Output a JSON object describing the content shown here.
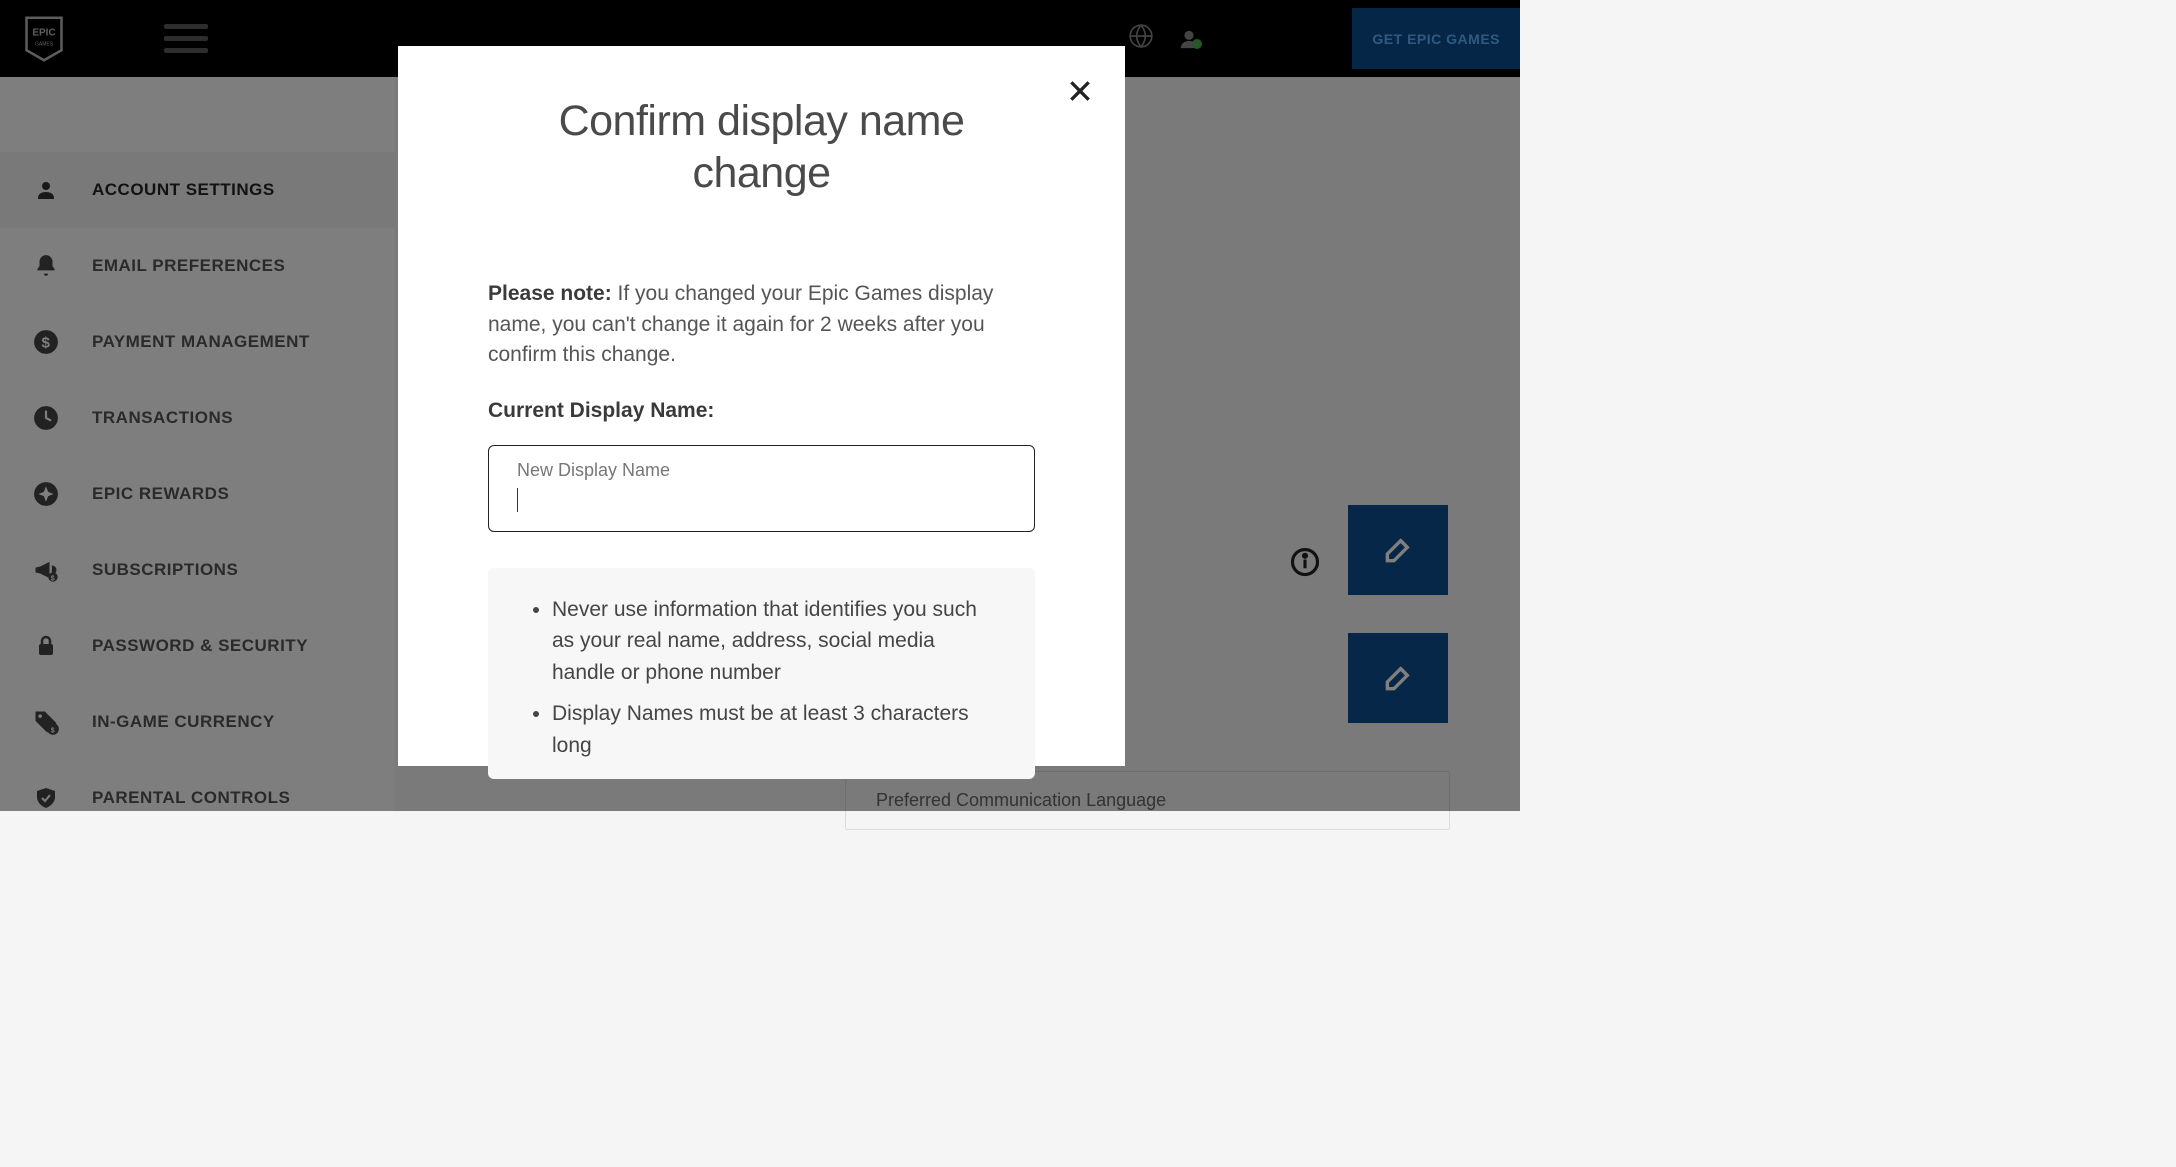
{
  "header": {
    "logo_text": "EPIC GAMES",
    "get_button": "GET EPIC GAMES"
  },
  "sidebar": {
    "items": [
      {
        "label": "ACCOUNT SETTINGS"
      },
      {
        "label": "EMAIL PREFERENCES"
      },
      {
        "label": "PAYMENT MANAGEMENT"
      },
      {
        "label": "TRANSACTIONS"
      },
      {
        "label": "EPIC REWARDS"
      },
      {
        "label": "SUBSCRIPTIONS"
      },
      {
        "label": "PASSWORD & SECURITY"
      },
      {
        "label": "IN-GAME CURRENCY"
      },
      {
        "label": "PARENTAL CONTROLS"
      }
    ]
  },
  "content": {
    "field_label": "Preferred Communication Language"
  },
  "modal": {
    "title": "Confirm display name change",
    "note_strong": "Please note:",
    "note_rest": " If you changed your Epic Games display name, you can't change it again for 2 weeks after you confirm this change.",
    "current_label": "Current Display Name:",
    "input_float_label": "New Display Name",
    "input_value": "",
    "tips": [
      "Never use information that identifies you such as your real name, address, social media handle or phone number",
      "Display Names must be at least 3 characters long"
    ]
  }
}
